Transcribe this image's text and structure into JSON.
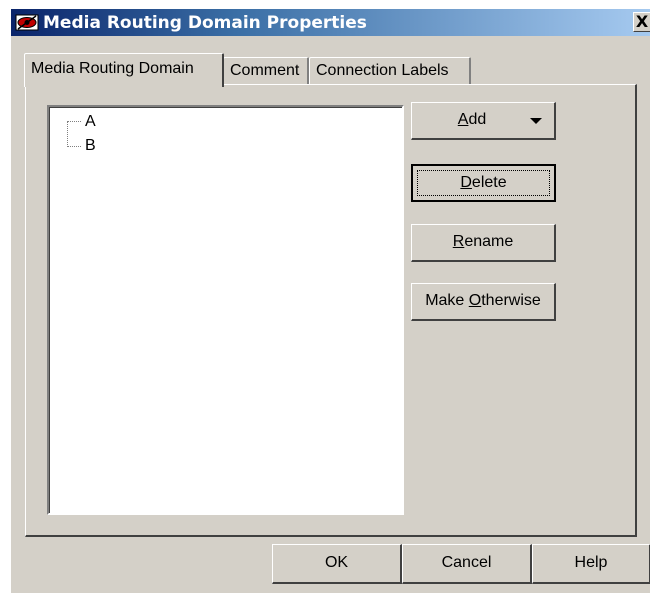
{
  "window": {
    "title": "Media Routing Domain Properties",
    "close_label": "X"
  },
  "tabs": [
    {
      "label": "Media Routing Domain",
      "active": true
    },
    {
      "label": "Comment",
      "active": false
    },
    {
      "label": "Connection Labels",
      "active": false
    }
  ],
  "tree": {
    "items": [
      "A",
      "B"
    ]
  },
  "buttons": {
    "add": {
      "pre": "",
      "mnemonic": "A",
      "post": "dd"
    },
    "delete": {
      "pre": "",
      "mnemonic": "D",
      "post": "elete"
    },
    "rename": {
      "pre": "",
      "mnemonic": "R",
      "post": "ename"
    },
    "make_otherwise": {
      "pre": "Make ",
      "mnemonic": "O",
      "post": "therwise"
    }
  },
  "footer": {
    "ok": "OK",
    "cancel": "Cancel",
    "help": "Help"
  }
}
